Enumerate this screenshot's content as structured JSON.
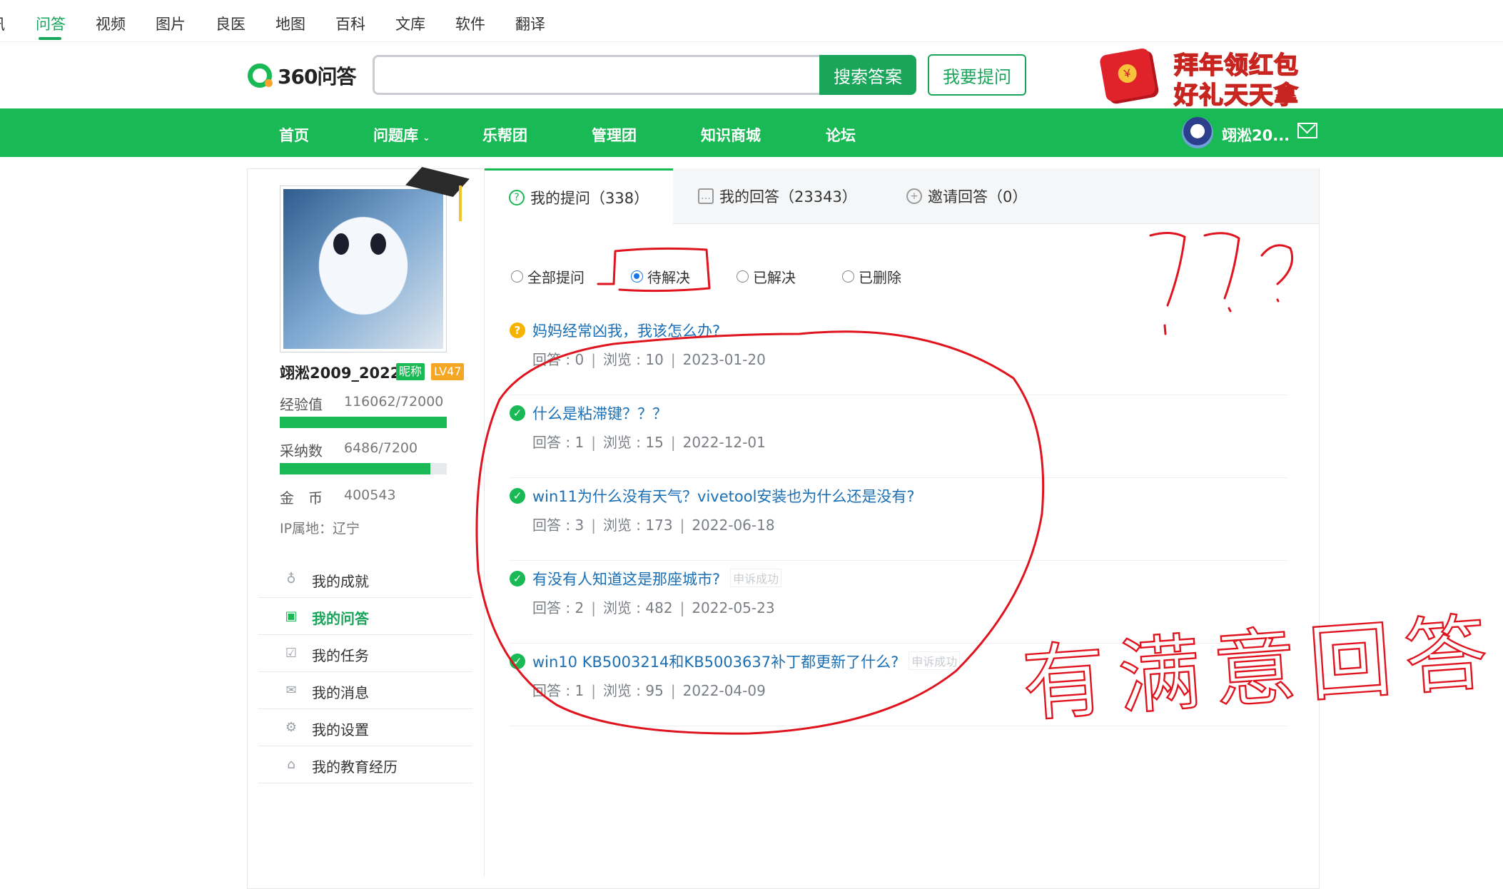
{
  "top_nav": {
    "items": [
      {
        "label": "讯",
        "active": false
      },
      {
        "label": "问答",
        "active": true
      },
      {
        "label": "视频",
        "active": false
      },
      {
        "label": "图片",
        "active": false
      },
      {
        "label": "良医",
        "active": false
      },
      {
        "label": "地图",
        "active": false
      },
      {
        "label": "百科",
        "active": false
      },
      {
        "label": "文库",
        "active": false
      },
      {
        "label": "软件",
        "active": false
      },
      {
        "label": "翻译",
        "active": false
      }
    ]
  },
  "header": {
    "logo_text": "360问答",
    "search": {
      "value": "",
      "placeholder": ""
    },
    "search_button": "搜索答案",
    "ask_button": "我要提问",
    "promo": {
      "line1": "拜年领红包",
      "line2": "好礼天天拿",
      "icon": "red-envelope-icon"
    }
  },
  "main_nav": {
    "items": [
      "首页",
      "问题库",
      "乐帮团",
      "管理团",
      "知识商城",
      "论坛"
    ],
    "username": "翊淞20..."
  },
  "profile": {
    "username": "翊淞2009_2022",
    "nickname_badge": "昵称",
    "level_badge": "LV47",
    "experience": {
      "label": "经验值",
      "value": "116062/72000",
      "progress": 1.0
    },
    "adoption": {
      "label": "采纳数",
      "value": "6486/7200",
      "progress": 0.9
    },
    "coins": {
      "label": "金　币",
      "value": "400543"
    },
    "ip_location": "IP属地：辽宁"
  },
  "side_menu": [
    {
      "label": "我的成就",
      "icon": "medal-icon",
      "active": false
    },
    {
      "label": "我的问答",
      "icon": "qa-icon",
      "active": true
    },
    {
      "label": "我的任务",
      "icon": "calendar-check-icon",
      "active": false
    },
    {
      "label": "我的消息",
      "icon": "mail-icon",
      "active": false
    },
    {
      "label": "我的设置",
      "icon": "gear-icon",
      "active": false
    },
    {
      "label": "我的教育经历",
      "icon": "graduation-cap-icon",
      "active": false
    }
  ],
  "tabs": [
    {
      "label": "我的提问（338）",
      "active": true
    },
    {
      "label": "我的回答（23343）",
      "active": false
    },
    {
      "label": "邀请回答（0）",
      "active": false
    }
  ],
  "filters": [
    {
      "label": "全部提问",
      "checked": false
    },
    {
      "label": "待解决",
      "checked": true
    },
    {
      "label": "已解决",
      "checked": false
    },
    {
      "label": "已删除",
      "checked": false
    }
  ],
  "questions": [
    {
      "title": "妈妈经常凶我，我该怎么办?",
      "status": "pending",
      "tag": "",
      "answers": "回答 : 0",
      "views": "浏览 : 10",
      "date": "2023-01-20"
    },
    {
      "title": "什么是粘滞键？？？",
      "status": "solved",
      "tag": "",
      "answers": "回答 : 1",
      "views": "浏览 : 15",
      "date": "2022-12-01"
    },
    {
      "title": "win11为什么没有天气？vivetool安装也为什么还是没有?",
      "status": "solved",
      "tag": "",
      "answers": "回答 : 3",
      "views": "浏览 : 173",
      "date": "2022-06-18"
    },
    {
      "title": "有没有人知道这是那座城市?",
      "status": "solved",
      "tag": "申诉成功",
      "answers": "回答 : 2",
      "views": "浏览 : 482",
      "date": "2022-05-23"
    },
    {
      "title": "win10 KB5003214和KB5003637补丁都更新了什么?",
      "status": "solved",
      "tag": "申诉成功",
      "answers": "回答 : 1",
      "views": "浏览 : 95",
      "date": "2022-04-09"
    }
  ],
  "annotations": {
    "question_marks": "???",
    "note": "有满意回答",
    "color": "#e0141e"
  }
}
